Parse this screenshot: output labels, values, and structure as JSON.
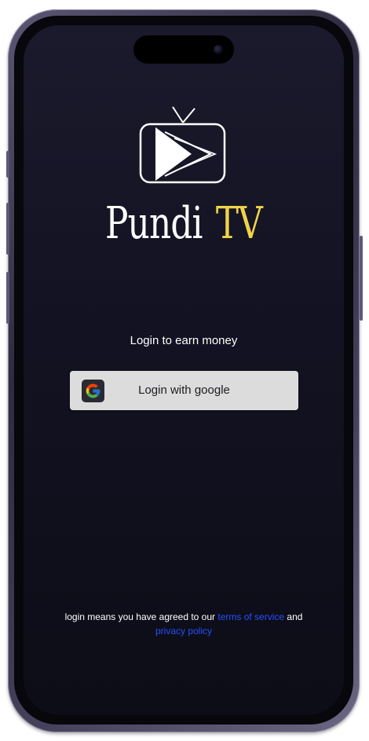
{
  "app": {
    "brand_part1": "Pundi",
    "brand_part2": "TV",
    "logo_icon": "tv-play-icon"
  },
  "login": {
    "tagline": "Login to earn money",
    "google_button_label": "Login with google",
    "google_icon": "google-g-icon"
  },
  "legal": {
    "prefix": "login means you have agreed to our",
    "terms_link": "terms of service",
    "conjunction": "and",
    "privacy_link": "privacy policy"
  },
  "colors": {
    "background_top": "#1b1a2c",
    "background_bottom": "#0d0d17",
    "brand_accent": "#f1d34a",
    "link": "#2450ff",
    "button_bg": "#dcdcdc"
  }
}
